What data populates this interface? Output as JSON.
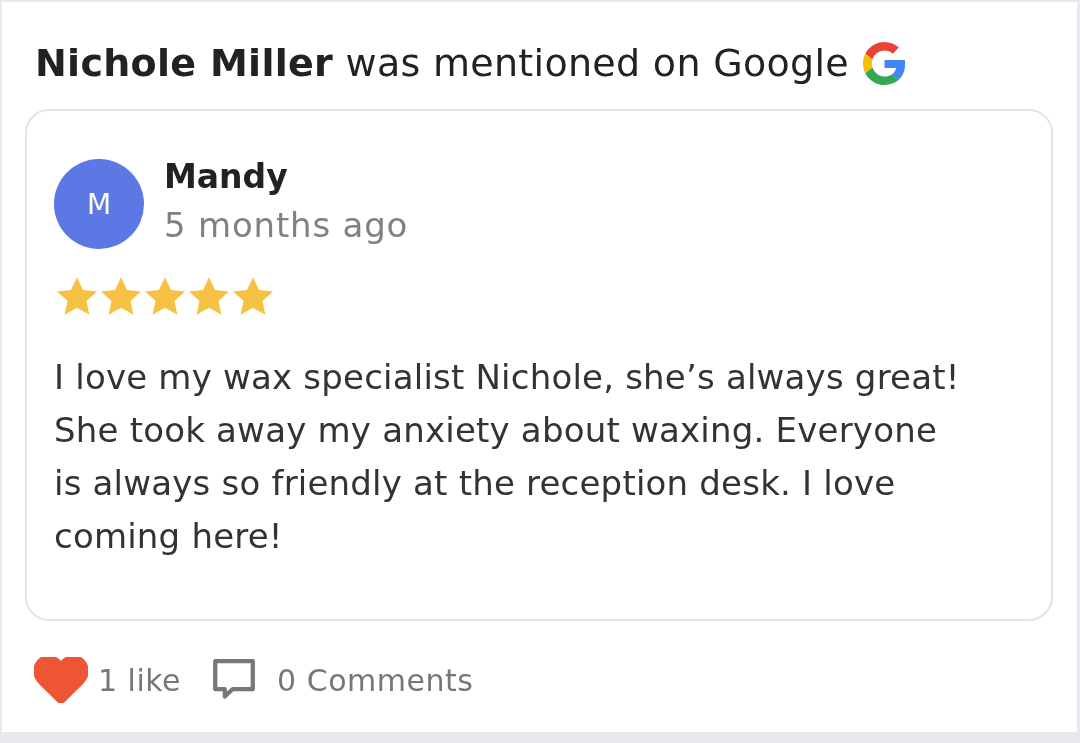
{
  "header": {
    "title": "**Nichole Miller** was mentioned on Google"
  },
  "review": {
    "avatar_letter": "M",
    "author": "Mandy",
    "time": "5 months ago",
    "stars": 5,
    "text": "I love my wax specialist Nichole, she’s always great! She took away my anxiety about waxing. Everyone is always so friendly at the reception desk. I love coming here!"
  },
  "footer": {
    "likes": "1 like",
    "liked": true,
    "comments": "0 Comments"
  }
}
